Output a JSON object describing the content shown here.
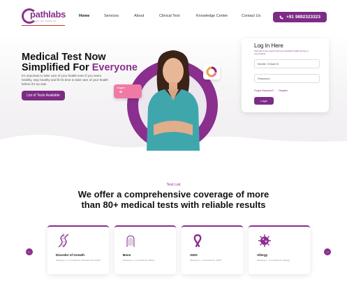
{
  "header": {
    "logo_text": "pathlabs",
    "logo_tagline": "Complete Care, Healthy Life",
    "nav": [
      "Home",
      "Services",
      "About",
      "Clinical Test",
      "Knowledge Center",
      "Contact Us"
    ],
    "phone": "+91 9892323323"
  },
  "hero": {
    "title_line1": "Medical Test Now",
    "title_line2_prefix": "Simplified For ",
    "title_line2_accent": "Everyone",
    "subtitle": "It's important to take care of your health even if you seem healthy, stay healthy and fit it's time to take care of your health before it's too late.",
    "cta": "List of Tests Available",
    "oxygen_label": "Oxygen",
    "oxygen_value": "95",
    "oxygen_unit": "%"
  },
  "login": {
    "title": "Log In Here",
    "subtitle": "View all of your reports and your beautiful health journey in one timeline.",
    "mobile_placeholder": "Mobile / Email ID",
    "password_placeholder": "Password",
    "forgot": "Forgot Password?",
    "register": "Register",
    "button": "Login"
  },
  "tests": {
    "label": "Test List",
    "heading_line1": "We offer a comprehensive coverage of more",
    "heading_line2": "than 80+ medical tests with reliable results",
    "items": [
      {
        "name": "Disorder of Growth",
        "desc": "Showing 1 - 1 of results for \"Disorder Of Growth\"",
        "icon": "dna-icon"
      },
      {
        "name": "Bone",
        "desc": "Showing 1 - 1 of results for \"Bone\"",
        "icon": "bone-icon"
      },
      {
        "name": "AIDS",
        "desc": "Showing 1 - 1 of results for \"AIDS\"",
        "icon": "ribbon-icon"
      },
      {
        "name": "Allergy",
        "desc": "Showing 1 - 1 of results for \"Allergy\"",
        "icon": "virus-icon"
      }
    ]
  },
  "colors": {
    "accent": "#8a2f8e",
    "button": "#7d2c86",
    "pink": "#ef7aa3"
  }
}
